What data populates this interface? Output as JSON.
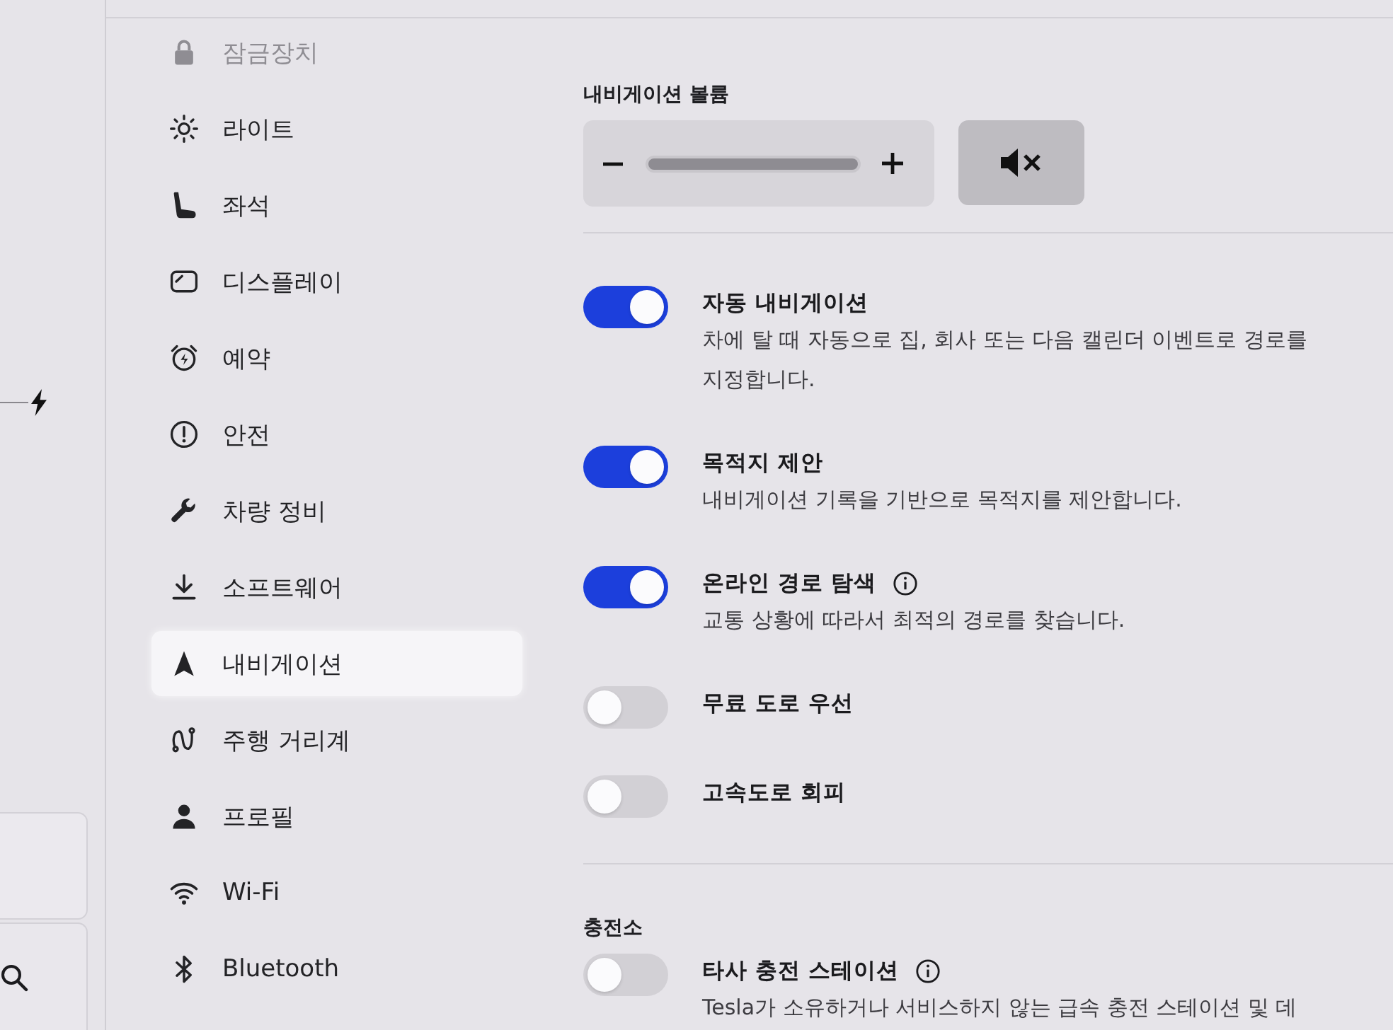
{
  "sidebar": {
    "items": [
      {
        "label": "잠금장치",
        "selected": false,
        "dimmed": true
      },
      {
        "label": "라이트",
        "selected": false,
        "dimmed": false
      },
      {
        "label": "좌석",
        "selected": false,
        "dimmed": false
      },
      {
        "label": "디스플레이",
        "selected": false,
        "dimmed": false
      },
      {
        "label": "예약",
        "selected": false,
        "dimmed": false
      },
      {
        "label": "안전",
        "selected": false,
        "dimmed": false
      },
      {
        "label": "차량 정비",
        "selected": false,
        "dimmed": false
      },
      {
        "label": "소프트웨어",
        "selected": false,
        "dimmed": false
      },
      {
        "label": "내비게이션",
        "selected": true,
        "dimmed": false
      },
      {
        "label": "주행 거리계",
        "selected": false,
        "dimmed": false
      },
      {
        "label": "프로필",
        "selected": false,
        "dimmed": false
      },
      {
        "label": "Wi-Fi",
        "selected": false,
        "dimmed": false
      },
      {
        "label": "Bluetooth",
        "selected": false,
        "dimmed": false
      }
    ]
  },
  "navigation_volume": {
    "label": "내비게이션 볼륨",
    "level": 1,
    "muted": true
  },
  "settings": [
    {
      "title": "자동 내비게이션",
      "description": "차에 탈 때 자동으로 집, 회사 또는 다음 캘린더 이벤트로 경로를 지정합니다.",
      "on": true,
      "info": false
    },
    {
      "title": "목적지 제안",
      "description": "내비게이션 기록을 기반으로 목적지를 제안합니다.",
      "on": true,
      "info": false
    },
    {
      "title": "온라인 경로 탐색",
      "description": "교통 상황에 따라서 최적의 경로를 찾습니다.",
      "on": true,
      "info": true
    },
    {
      "title": "무료 도로 우선",
      "on": false,
      "info": false
    },
    {
      "title": "고속도로 회피",
      "on": false,
      "info": false
    }
  ],
  "charging_stations": {
    "heading": "충전소",
    "settings": [
      {
        "title": "타사 충전 스테이션",
        "description": "Tesla가 소유하거나 서비스하지 않는 급속 충전 스테이션 및 데",
        "on": false,
        "info": true
      }
    ]
  }
}
